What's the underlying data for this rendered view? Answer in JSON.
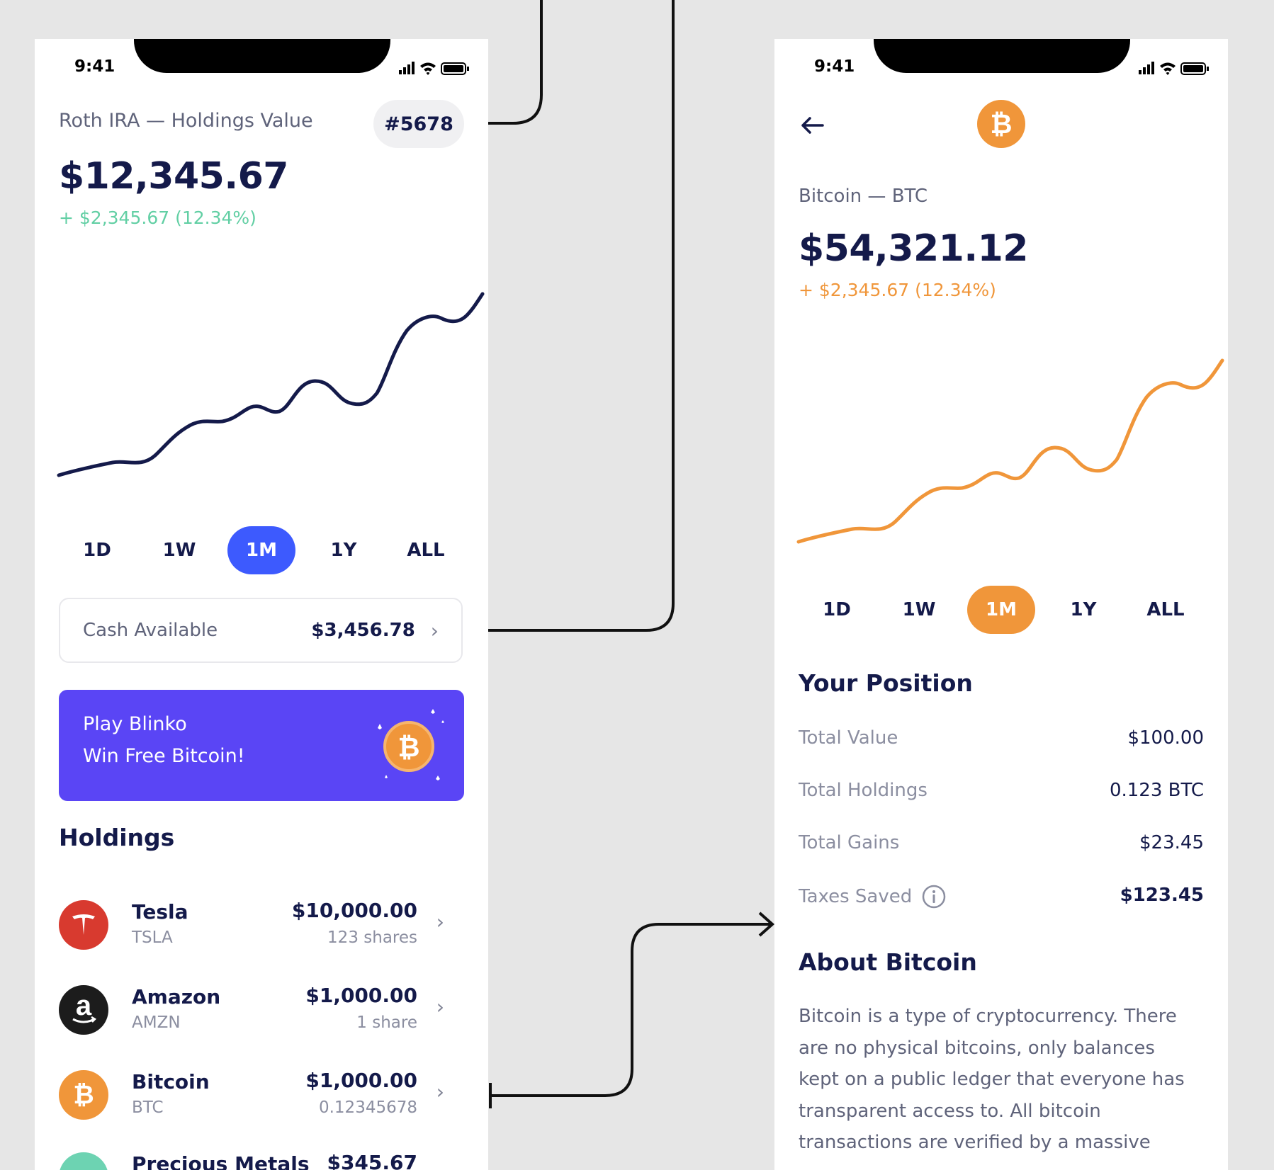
{
  "status_bar": {
    "time": "9:41"
  },
  "portfolio": {
    "title": "Roth IRA — Holdings Value",
    "account_number": "#5678",
    "value": "$12,345.67",
    "change": "+ $2,345.67 (12.34%)",
    "ranges": [
      "1D",
      "1W",
      "1M",
      "1Y",
      "ALL"
    ],
    "selected_range": "1M",
    "cash_label": "Cash Available",
    "cash_value": "$3,456.78",
    "promo_line1": "Play Blinko",
    "promo_line2": "Win Free Bitcoin!",
    "holdings_title": "Holdings",
    "holdings": [
      {
        "name": "Tesla",
        "ticker": "TSLA",
        "value": "$10,000.00",
        "sub": "123 shares",
        "icon": "tesla-logo-icon",
        "color": "#d83a2f"
      },
      {
        "name": "Amazon",
        "ticker": "AMZN",
        "value": "$1,000.00",
        "sub": "1 share",
        "icon": "amazon-logo-icon",
        "color": "#1c1c1c"
      },
      {
        "name": "Bitcoin",
        "ticker": "BTC",
        "value": "$1,000.00",
        "sub": "0.12345678",
        "icon": "bitcoin-logo-icon",
        "color": "#f0963a"
      },
      {
        "name": "Precious Metals",
        "ticker": "",
        "value": "$345.67",
        "sub": "",
        "icon": "precious-metals-icon",
        "color": "#6dd3b2"
      }
    ]
  },
  "asset": {
    "title": "Bitcoin — BTC",
    "value": "$54,321.12",
    "change": "+ $2,345.67 (12.34%)",
    "ranges": [
      "1D",
      "1W",
      "1M",
      "1Y",
      "ALL"
    ],
    "selected_range": "1M",
    "position_title": "Your Position",
    "position_rows": [
      {
        "label": "Total Value",
        "value": "$100.00"
      },
      {
        "label": "Total Holdings",
        "value": "0.123 BTC"
      },
      {
        "label": "Total Gains",
        "value": "$23.45"
      },
      {
        "label": "Taxes Saved",
        "value": "$123.45"
      }
    ],
    "about_title": "About Bitcoin",
    "about_text": "Bitcoin is a type of cryptocurrency. There are no physical bitcoins, only balances kept on a public ledger that everyone has transparent access to. All bitcoin transactions are verified by a massive"
  },
  "colors": {
    "navy": "#141a4a",
    "accent_blue": "#3d5afe",
    "bitcoin_orange": "#f0963a",
    "positive_green": "#62cfa4",
    "promo_purple": "#5a45f5"
  }
}
